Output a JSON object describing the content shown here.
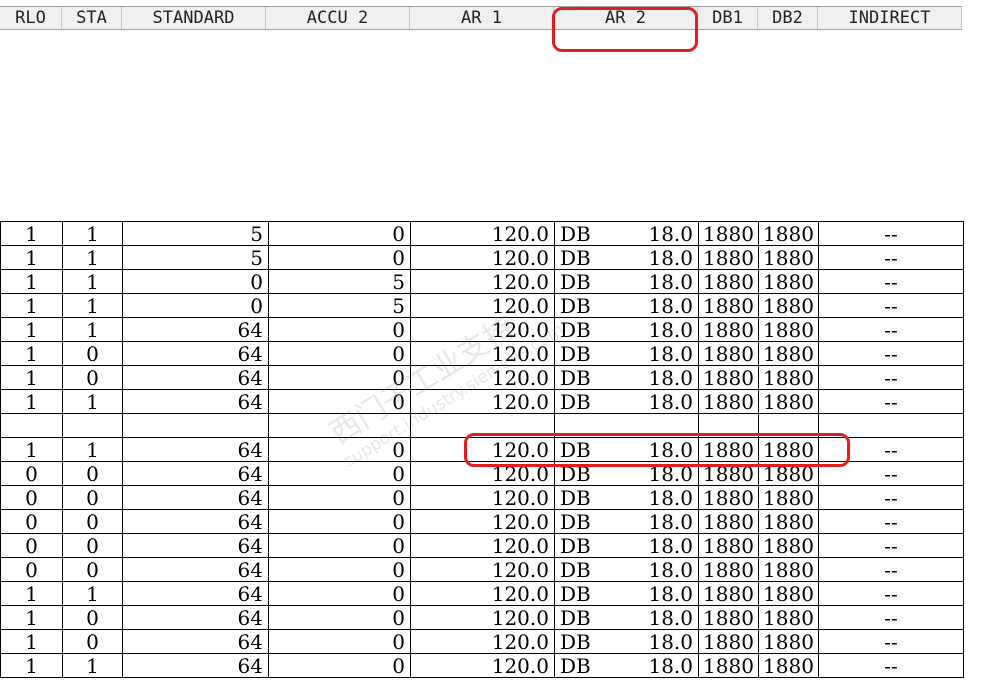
{
  "columns": [
    "RLO",
    "STA",
    "STANDARD",
    "ACCU 2",
    "AR 1",
    "AR 2",
    "DB1",
    "DB2",
    "INDIRECT"
  ],
  "rows": [
    {
      "rlo": "1",
      "sta": "1",
      "standard": "5",
      "accu2": "0",
      "ar1": "120.0",
      "ar2_prefix": "DB",
      "ar2": "18.0",
      "db1": "1880",
      "db2": "1880",
      "indirect": "--"
    },
    {
      "rlo": "1",
      "sta": "1",
      "standard": "5",
      "accu2": "0",
      "ar1": "120.0",
      "ar2_prefix": "DB",
      "ar2": "18.0",
      "db1": "1880",
      "db2": "1880",
      "indirect": "--"
    },
    {
      "rlo": "1",
      "sta": "1",
      "standard": "0",
      "accu2": "5",
      "ar1": "120.0",
      "ar2_prefix": "DB",
      "ar2": "18.0",
      "db1": "1880",
      "db2": "1880",
      "indirect": "--"
    },
    {
      "rlo": "1",
      "sta": "1",
      "standard": "0",
      "accu2": "5",
      "ar1": "120.0",
      "ar2_prefix": "DB",
      "ar2": "18.0",
      "db1": "1880",
      "db2": "1880",
      "indirect": "--"
    },
    {
      "rlo": "1",
      "sta": "1",
      "standard": "64",
      "accu2": "0",
      "ar1": "120.0",
      "ar2_prefix": "DB",
      "ar2": "18.0",
      "db1": "1880",
      "db2": "1880",
      "indirect": "--"
    },
    {
      "rlo": "1",
      "sta": "0",
      "standard": "64",
      "accu2": "0",
      "ar1": "120.0",
      "ar2_prefix": "DB",
      "ar2": "18.0",
      "db1": "1880",
      "db2": "1880",
      "indirect": "--"
    },
    {
      "rlo": "1",
      "sta": "0",
      "standard": "64",
      "accu2": "0",
      "ar1": "120.0",
      "ar2_prefix": "DB",
      "ar2": "18.0",
      "db1": "1880",
      "db2": "1880",
      "indirect": "--"
    },
    {
      "rlo": "1",
      "sta": "1",
      "standard": "64",
      "accu2": "0",
      "ar1": "120.0",
      "ar2_prefix": "DB",
      "ar2": "18.0",
      "db1": "1880",
      "db2": "1880",
      "indirect": "--"
    },
    {
      "rlo": "",
      "sta": "",
      "standard": "",
      "accu2": "",
      "ar1": "",
      "ar2_prefix": "",
      "ar2": "",
      "db1": "",
      "db2": "",
      "indirect": ""
    },
    {
      "rlo": "1",
      "sta": "1",
      "standard": "64",
      "accu2": "0",
      "ar1": "120.0",
      "ar2_prefix": "DB",
      "ar2": "18.0",
      "db1": "1880",
      "db2": "1880",
      "indirect": "--"
    },
    {
      "rlo": "0",
      "sta": "0",
      "standard": "64",
      "accu2": "0",
      "ar1": "120.0",
      "ar2_prefix": "DB",
      "ar2": "18.0",
      "db1": "1880",
      "db2": "1880",
      "indirect": "--"
    },
    {
      "rlo": "0",
      "sta": "0",
      "standard": "64",
      "accu2": "0",
      "ar1": "120.0",
      "ar2_prefix": "DB",
      "ar2": "18.0",
      "db1": "1880",
      "db2": "1880",
      "indirect": "--"
    },
    {
      "rlo": "0",
      "sta": "0",
      "standard": "64",
      "accu2": "0",
      "ar1": "120.0",
      "ar2_prefix": "DB",
      "ar2": "18.0",
      "db1": "1880",
      "db2": "1880",
      "indirect": "--"
    },
    {
      "rlo": "0",
      "sta": "0",
      "standard": "64",
      "accu2": "0",
      "ar1": "120.0",
      "ar2_prefix": "DB",
      "ar2": "18.0",
      "db1": "1880",
      "db2": "1880",
      "indirect": "--"
    },
    {
      "rlo": "0",
      "sta": "0",
      "standard": "64",
      "accu2": "0",
      "ar1": "120.0",
      "ar2_prefix": "DB",
      "ar2": "18.0",
      "db1": "1880",
      "db2": "1880",
      "indirect": "--"
    },
    {
      "rlo": "1",
      "sta": "1",
      "standard": "64",
      "accu2": "0",
      "ar1": "120.0",
      "ar2_prefix": "DB",
      "ar2": "18.0",
      "db1": "1880",
      "db2": "1880",
      "indirect": "--"
    },
    {
      "rlo": "1",
      "sta": "0",
      "standard": "64",
      "accu2": "0",
      "ar1": "120.0",
      "ar2_prefix": "DB",
      "ar2": "18.0",
      "db1": "1880",
      "db2": "1880",
      "indirect": "--"
    },
    {
      "rlo": "1",
      "sta": "0",
      "standard": "64",
      "accu2": "0",
      "ar1": "120.0",
      "ar2_prefix": "DB",
      "ar2": "18.0",
      "db1": "1880",
      "db2": "1880",
      "indirect": "--"
    },
    {
      "rlo": "1",
      "sta": "1",
      "standard": "64",
      "accu2": "0",
      "ar1": "120.0",
      "ar2_prefix": "DB",
      "ar2": "18.0",
      "db1": "1880",
      "db2": "1880",
      "indirect": "--"
    }
  ],
  "watermark": {
    "cn": "西门子工业支持",
    "url": "support.industry.siemens.com"
  },
  "highlight_color": "#e02020"
}
